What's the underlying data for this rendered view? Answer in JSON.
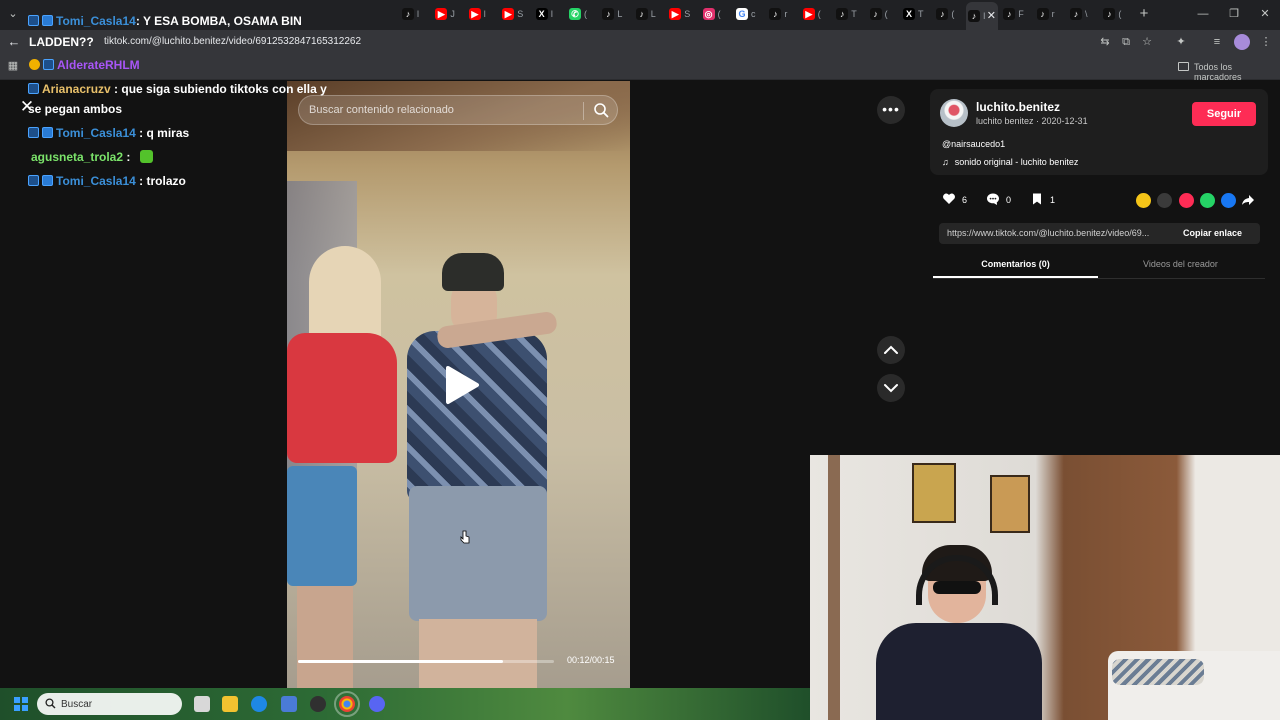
{
  "browser": {
    "active_tab_title": "I",
    "tabs": [
      {
        "icon": "tiktok-icon",
        "title": "l"
      },
      {
        "icon": "youtube-icon",
        "title": "J"
      },
      {
        "icon": "youtube-icon",
        "title": "l"
      },
      {
        "icon": "youtube-icon",
        "title": "S"
      },
      {
        "icon": "x-icon",
        "title": "I"
      },
      {
        "icon": "whatsapp-icon",
        "title": "("
      },
      {
        "icon": "tiktok-icon",
        "title": "L"
      },
      {
        "icon": "tiktok-icon",
        "title": "L"
      },
      {
        "icon": "youtube-icon",
        "title": "S"
      },
      {
        "icon": "instagram-icon",
        "title": "("
      },
      {
        "icon": "google-icon",
        "title": "c"
      },
      {
        "icon": "tiktok-icon",
        "title": "r"
      },
      {
        "icon": "youtube-icon",
        "title": "("
      },
      {
        "icon": "tiktok-icon",
        "title": "T"
      },
      {
        "icon": "tiktok-icon",
        "title": "("
      },
      {
        "icon": "x-icon",
        "title": "T"
      },
      {
        "icon": "tiktok-icon",
        "title": "("
      },
      {
        "icon": "tiktok-icon",
        "title": "I"
      },
      {
        "icon": "tiktok-icon",
        "title": "F"
      },
      {
        "icon": "tiktok-icon",
        "title": "r"
      },
      {
        "icon": "tiktok-icon",
        "title": "\\"
      },
      {
        "icon": "tiktok-icon",
        "title": "("
      }
    ],
    "url": "tiktok.com/@luchito.benitez/video/6912532847165312262",
    "bookmarks_label": "Todos los marcadores"
  },
  "overlay_chat_top": [
    {
      "user": "Tomi_Casla14",
      "message": ": Y ESA BOMBA, OSAMA BIN",
      "color": "#3b8fd8"
    },
    {
      "user": "LADDEN??",
      "message": "",
      "color": "#ffffff"
    },
    {
      "user": "AlderateRHLM",
      "message": "",
      "color": "#a855f7"
    }
  ],
  "overlay_chat": [
    {
      "user": "Arianacruzv",
      "message": ": que siga subiendo tiktoks con ella y",
      "user_color": "#e8c06a",
      "badge": true
    },
    {
      "user": "",
      "message": "se pegan ambos",
      "user_color": "#ffffff",
      "badge": false
    },
    {
      "user": "Tomi_Casla14",
      "message": ": q miras",
      "user_color": "#3b8fd8",
      "badge": true
    },
    {
      "user": "agusneta_trola2",
      "message": ":",
      "user_color": "#7be36a",
      "badge": false
    },
    {
      "user": "Tomi_Casla14",
      "message": ": trolazo",
      "user_color": "#3b8fd8",
      "badge": true
    }
  ],
  "video": {
    "search_placeholder": "Buscar contenido relacionado",
    "progress_fraction": 0.8,
    "time": "00:12/00:15"
  },
  "creator": {
    "name": "luchito.benitez",
    "subtitle": "luchito benitez · 2020-12-31",
    "follow_label": "Seguir",
    "description": "@nairsaucedo1",
    "music": "sonido original - luchito benitez"
  },
  "actions": {
    "likes": "6",
    "comments": "0",
    "saves": "1"
  },
  "share_colors": [
    "#f5c518",
    "#3a3a3a",
    "#fe2c55",
    "#25d366",
    "#1877f2"
  ],
  "link": {
    "url": "https://www.tiktok.com/@luchito.benitez/video/69...",
    "copy_label": "Copiar enlace"
  },
  "panel_tabs": {
    "comments": "Comentarios (0)",
    "creator_videos": "Videos del creador"
  },
  "taskbar": {
    "search_placeholder": "Buscar"
  }
}
